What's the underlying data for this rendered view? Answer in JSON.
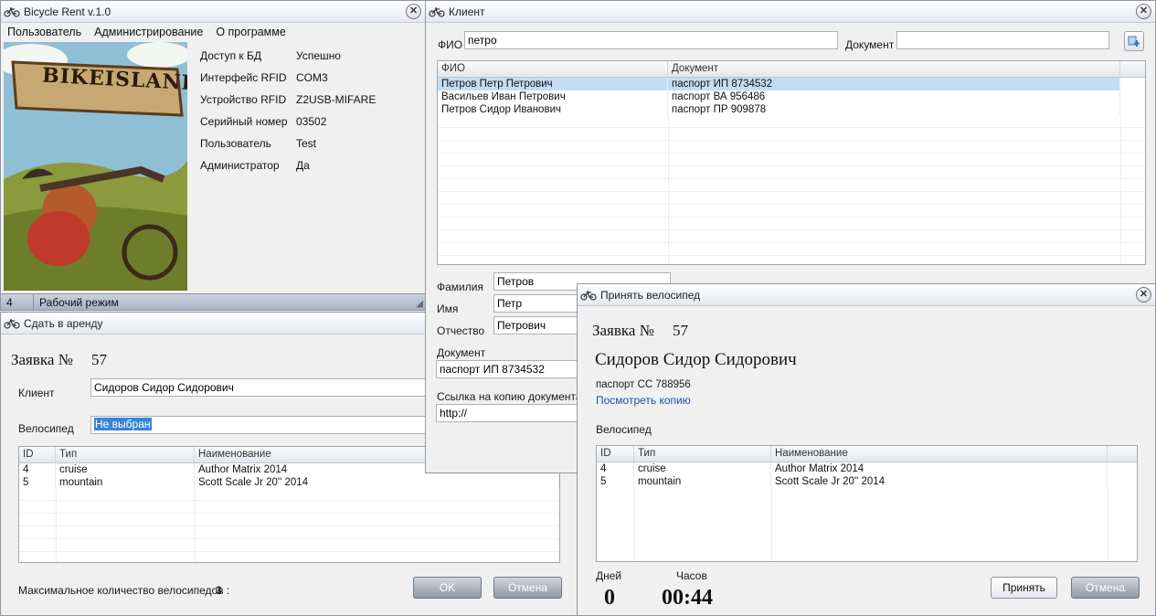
{
  "main_window": {
    "title": "Bicycle Rent v.1.0",
    "menu": [
      "Пользователь",
      "Администрирование",
      "О программе"
    ],
    "banner_text": "BIKEISLAND",
    "info": [
      {
        "label": "Доступ к БД",
        "value": "Успешно"
      },
      {
        "label": "Интерфейс RFID",
        "value": "COM3"
      },
      {
        "label": "Устройство RFID",
        "value": "Z2USB-MIFARE"
      },
      {
        "label": "Серийный номер",
        "value": "03502"
      },
      {
        "label": "Пользователь",
        "value": "Test"
      },
      {
        "label": "Администратор",
        "value": "Да"
      }
    ],
    "status": {
      "count": "4",
      "mode": "Рабочий режим"
    }
  },
  "rent_window": {
    "title": "Сдать в аренду",
    "order_label": "Заявка №",
    "order_number": "57",
    "client_label": "Клиент",
    "client_value": "Сидоров Сидор Сидорович",
    "bike_label": "Велосипед",
    "bike_value": "Не выбран",
    "columns": [
      "ID",
      "Тип",
      "Наименование"
    ],
    "rows": [
      [
        "4",
        "cruise",
        "Author Matrix 2014"
      ],
      [
        "5",
        "mountain",
        "Scott Scale Jr 20'' 2014"
      ]
    ],
    "max_label": "Максимальное количество велосипедов :",
    "max_value": "3",
    "ok_label": "OK",
    "cancel_label": "Отмена"
  },
  "client_window": {
    "title": "Клиент",
    "fio_label": "ФИО",
    "fio_value": "петро",
    "doc_label": "Документ",
    "doc_value": "",
    "columns": [
      "ФИО",
      "Документ"
    ],
    "rows": [
      [
        "Петров Петр Петрович",
        "паспорт ИП 8734532"
      ],
      [
        "Васильев Иван Петрович",
        "паспорт ВА 956486"
      ],
      [
        "Петров Сидор Иванович",
        "паспорт ПР 909878"
      ]
    ],
    "surname_label": "Фамилия",
    "surname_value": "Петров",
    "name_label": "Имя",
    "name_value": "Петр",
    "patronymic_label": "Отчество",
    "patronymic_value": "Петрович",
    "document_label": "Документ",
    "document_value": "паспорт ИП 8734532",
    "copy_label": "Ссылка на копию документа",
    "copy_value": "http://"
  },
  "accept_window": {
    "title": "Принять велосипед",
    "order_label": "Заявка №",
    "order_number": "57",
    "client_name": "Сидоров Сидор Сидорович",
    "passport": "паспорт СС 788956",
    "view_copy": "Посмотреть копию",
    "bike_label": "Велосипед",
    "columns": [
      "ID",
      "Тип",
      "Наименование"
    ],
    "rows": [
      [
        "4",
        "cruise",
        "Author Matrix 2014"
      ],
      [
        "5",
        "mountain",
        "Scott Scale Jr 20'' 2014"
      ]
    ],
    "days_label": "Дней",
    "days_value": "0",
    "hours_label": "Часов",
    "hours_value": "00:44",
    "accept_label": "Принять",
    "cancel_label": "Отмена"
  }
}
